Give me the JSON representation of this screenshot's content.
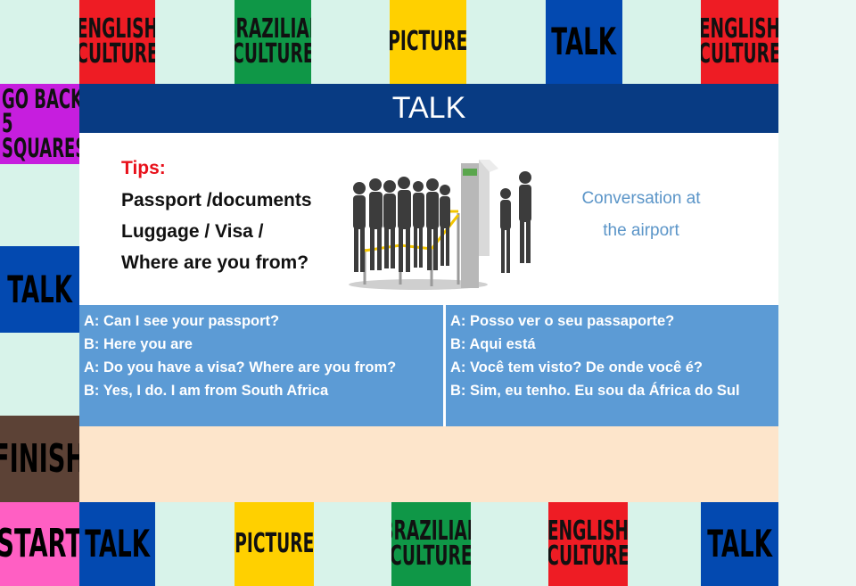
{
  "board": {
    "top": [
      {
        "label": "ENGLISH\nCULTURE",
        "color": "red"
      },
      {
        "label": "BRAZILIAN\nCULTURE",
        "color": "green"
      },
      {
        "label": "PICTURE",
        "color": "yellow"
      },
      {
        "label": "TALK",
        "color": "blue"
      },
      {
        "label": "ENGLISH\nCULTURE",
        "color": "red"
      }
    ],
    "left": [
      {
        "label": "GO BACK\n5 SQUARES",
        "color": "purple"
      },
      {
        "label": "TALK",
        "color": "blue"
      },
      {
        "label": "FINISH",
        "color": "brown"
      },
      {
        "label": "START",
        "color": "pink"
      }
    ],
    "bottom": [
      {
        "label": "TALK",
        "color": "blue"
      },
      {
        "label": "PICTURE",
        "color": "yellow"
      },
      {
        "label": "BRAZILIAN\nCULTURE",
        "color": "green"
      },
      {
        "label": "ENGLISH\nCULTURE",
        "color": "red"
      },
      {
        "label": "TALK",
        "color": "blue"
      }
    ]
  },
  "card": {
    "title": "TALK",
    "tips_title": "Tips:",
    "tips_lines": [
      "Passport /documents",
      "Luggage / Visa /",
      "Where are you from?"
    ],
    "conversation_line1": "Conversation at",
    "conversation_line2": "the airport",
    "illustration_icon": "airport-queue-illustration",
    "dialog_english": [
      "A: Can I see your passport?",
      "B: Here you are",
      "A: Do you have a visa? Where are you from?",
      "B: Yes, I do. I am from South Africa"
    ],
    "dialog_portuguese": [
      "A: Posso ver o seu passaporte?",
      "B: Aqui está",
      "A: Você tem visto? De onde você é?",
      "B: Sim, eu tenho. Eu sou da África do Sul"
    ]
  },
  "colors": {
    "red": "#ee1c24",
    "green": "#0f9747",
    "yellow": "#ffd000",
    "blue": "#0349b0",
    "purple": "#c61ede",
    "brown": "#5c4236",
    "pink": "#ff5fc3",
    "header": "#083b83",
    "dialog": "#5c9bd5",
    "beige": "#fde5cb",
    "background": "#d8f3ea"
  }
}
